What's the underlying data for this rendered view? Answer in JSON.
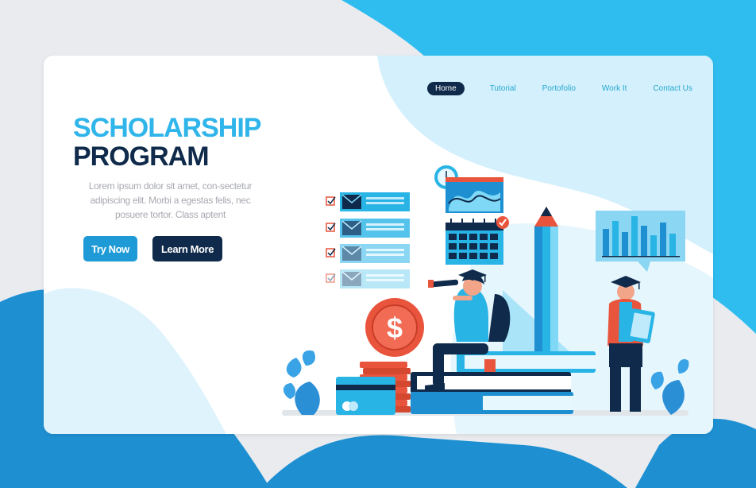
{
  "nav": {
    "items": [
      {
        "label": "Home",
        "active": true
      },
      {
        "label": "Tutorial",
        "active": false
      },
      {
        "label": "Portofolio",
        "active": false
      },
      {
        "label": "Work It",
        "active": false
      },
      {
        "label": "Contact Us",
        "active": false
      }
    ]
  },
  "hero": {
    "title_line1": "SCHOLARSHIP",
    "title_line2": "PROGRAM",
    "description": "Lorem ipsum dolor sit amet, con-sectetur adipiscing elit. Morbi a egestas felis, nec posuere tortor. Class aptent",
    "primary_button": "Try Now",
    "secondary_button": "Learn More"
  },
  "colors": {
    "accent_blue": "#2fb5ea",
    "navy": "#0f2a4a",
    "coral": "#e9543d",
    "light_blue": "#cdeefb"
  },
  "icons": [
    "envelope-icon",
    "checkbox-icon",
    "clock-icon",
    "calendar-icon",
    "check-badge-icon",
    "dollar-coin-icon",
    "pencil-icon",
    "bar-chart-icon",
    "graduation-cap-icon",
    "telescope-icon",
    "leaf-icon"
  ]
}
